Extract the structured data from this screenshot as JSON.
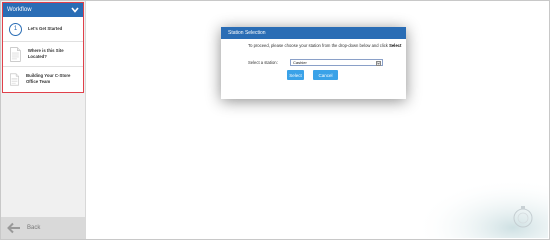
{
  "workflow": {
    "title": "Workflow",
    "items": [
      {
        "number": "1",
        "label": "Let's Get Started",
        "icon": "step-circle"
      },
      {
        "label": "Where is this Site Located?",
        "icon": "document-icon"
      },
      {
        "label": "Building Your C-Store Office Team",
        "icon": "document-icon"
      }
    ]
  },
  "back": {
    "label": "Back",
    "icon": "arrow-left-icon"
  },
  "dialog": {
    "title": "Station Selection",
    "message_prefix": "To proceed, please choose your station from the drop-down below and click ",
    "message_bold": "Select",
    "station_label": "Select a station:",
    "station_value": "Cashier",
    "select_label": "Select",
    "cancel_label": "Cancel"
  },
  "colors": {
    "accent": "#2a6db5",
    "button": "#3aa2e8",
    "highlight_border": "#e0404a"
  }
}
